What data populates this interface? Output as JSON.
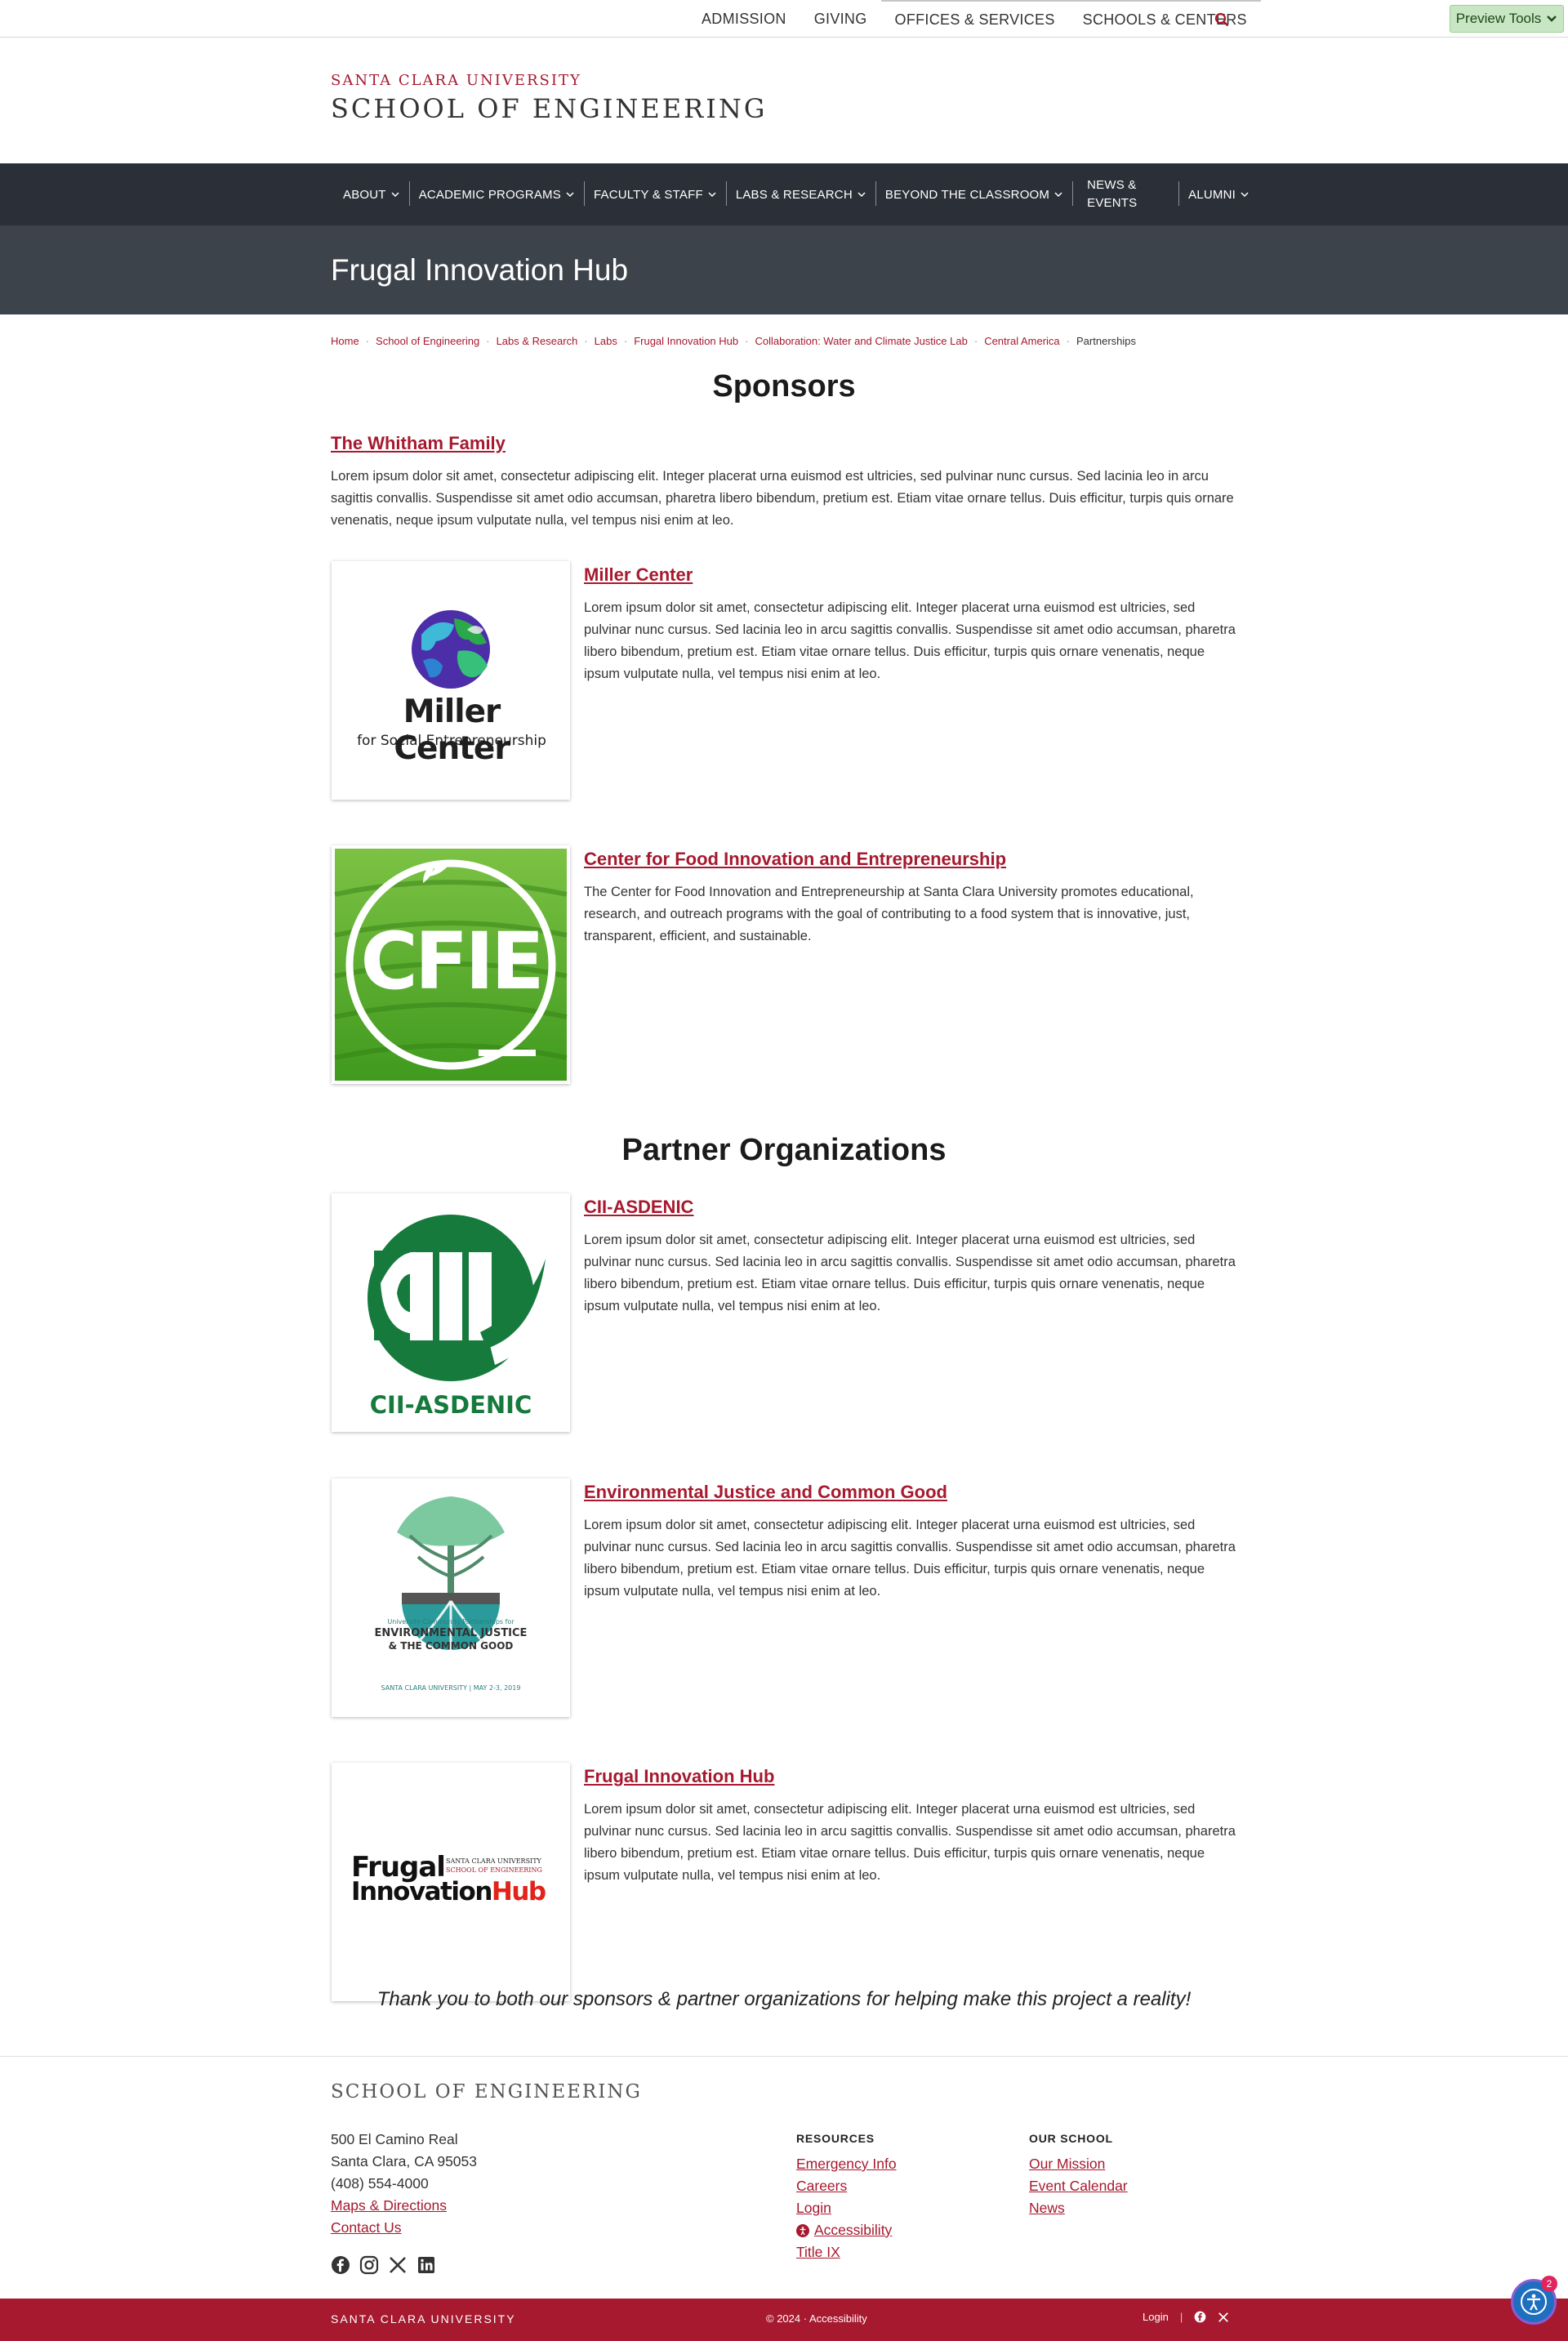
{
  "utility": {
    "links": [
      "ADMISSION",
      "GIVING",
      "OFFICES & SERVICES",
      "SCHOOLS & CENTERS"
    ],
    "preview_tools": "Preview Tools"
  },
  "brand": {
    "university": "SANTA CLARA UNIVERSITY",
    "school": "SCHOOL OF ENGINEERING"
  },
  "nav": {
    "items": [
      "ABOUT",
      "ACADEMIC PROGRAMS",
      "FACULTY & STAFF",
      "LABS & RESEARCH",
      "BEYOND THE CLASSROOM",
      "NEWS & EVENTS",
      "ALUMNI"
    ]
  },
  "hero": {
    "title": "Frugal Innovation Hub"
  },
  "breadcrumb": {
    "items": [
      "Home",
      "School of Engineering",
      "Labs & Research",
      "Labs",
      "Frugal Innovation Hub",
      "Collaboration: Water and Climate Justice Lab",
      "Central America"
    ],
    "current": "Partnerships"
  },
  "sponsors": {
    "heading": "Sponsors",
    "whitham": {
      "title": "The Whitham Family",
      "text": "Lorem ipsum dolor sit amet, consectetur adipiscing elit. Integer placerat urna euismod est ultricies, sed pulvinar nunc cursus. Sed lacinia leo in arcu sagittis convallis. Suspendisse sit amet odio accumsan, pharetra libero bibendum, pretium est. Etiam vitae ornare tellus. Duis efficitur, turpis quis ornare venenatis, neque ipsum vulputate nulla, vel tempus nisi enim at leo."
    },
    "miller": {
      "title": "Miller Center",
      "logo_line1": "Miller Center",
      "logo_line2": "for Social Entrepreneurship",
      "text": "Lorem ipsum dolor sit amet, consectetur adipiscing elit. Integer placerat urna euismod est ultricies, sed pulvinar nunc cursus. Sed lacinia leo in arcu sagittis convallis. Suspendisse sit amet odio accumsan, pharetra libero bibendum, pretium est. Etiam vitae ornare tellus. Duis efficitur, turpis quis ornare venenatis, neque ipsum vulputate nulla, vel tempus nisi enim at leo."
    },
    "cfie": {
      "title": "Center for Food Innovation and Entrepreneurship",
      "logo_text": "CFIE",
      "text": "The Center for Food Innovation and Entrepreneurship at Santa Clara University promotes educational, research, and outreach programs with the goal of contributing to a food system that is innovative, just, transparent, efficient, and sustainable."
    }
  },
  "partners": {
    "heading": "Partner Organizations",
    "cii": {
      "title": "CII-ASDENIC",
      "logo_text": "CII-ASDENIC",
      "text": "Lorem ipsum dolor sit amet, consectetur adipiscing elit. Integer placerat urna euismod est ultricies, sed pulvinar nunc cursus. Sed lacinia leo in arcu sagittis convallis. Suspendisse sit amet odio accumsan, pharetra libero bibendum, pretium est. Etiam vitae ornare tellus. Duis efficitur, turpis quis ornare venenatis, neque ipsum vulputate nulla, vel tempus nisi enim at leo."
    },
    "ej": {
      "title": "Environmental Justice and Common Good",
      "logo_line1": "University-Community Partnerships for",
      "logo_line2": "ENVIRONMENTAL JUSTICE",
      "logo_line3": "& THE COMMON GOOD",
      "logo_line4": "SANTA CLARA UNIVERSITY | MAY 2-3, 2019",
      "text": "Lorem ipsum dolor sit amet, consectetur adipiscing elit. Integer placerat urna euismod est ultricies, sed pulvinar nunc cursus. Sed lacinia leo in arcu sagittis convallis. Suspendisse sit amet odio accumsan, pharetra libero bibendum, pretium est. Etiam vitae ornare tellus. Duis efficitur, turpis quis ornare venenatis, neque ipsum vulputate nulla, vel tempus nisi enim at leo."
    },
    "fih": {
      "title": "Frugal Innovation Hub",
      "logo_word1": "Frugal",
      "logo_word2": "Innovation",
      "logo_word3": "Hub",
      "logo_small1": "SANTA CLARA UNIVERSITY",
      "logo_small2": "SCHOOL OF ENGINEERING",
      "text": "Lorem ipsum dolor sit amet, consectetur adipiscing elit. Integer placerat urna euismod est ultricies, sed pulvinar nunc cursus. Sed lacinia leo in arcu sagittis convallis. Suspendisse sit amet odio accumsan, pharetra libero bibendum, pretium est. Etiam vitae ornare tellus. Duis efficitur, turpis quis ornare venenatis, neque ipsum vulputate nulla, vel tempus nisi enim at leo."
    }
  },
  "thanks": "Thank you to both our sponsors & partner organizations for helping make this project a reality!",
  "footer": {
    "title": "SCHOOL OF ENGINEERING",
    "address1": "500 El Camino Real",
    "address2": "Santa Clara, CA 95053",
    "phone": "(408) 554-4000",
    "maps": "Maps & Directions",
    "contact": "Contact Us",
    "resources_heading": "RESOURCES",
    "resources": [
      "Emergency Info",
      "Careers",
      "Login",
      "Accessibility",
      "Title IX"
    ],
    "school_heading": "OUR SCHOOL",
    "school_links": [
      "Our Mission",
      "Event Calendar",
      "News"
    ]
  },
  "bottom": {
    "left": "SANTA CLARA UNIVERSITY",
    "center": "© 2024 · Accessibility",
    "login": "Login"
  },
  "a11y_badge": "2",
  "colors": {
    "brand": "#a6192e",
    "nav": "#2b3038",
    "hero": "#3d434b"
  }
}
